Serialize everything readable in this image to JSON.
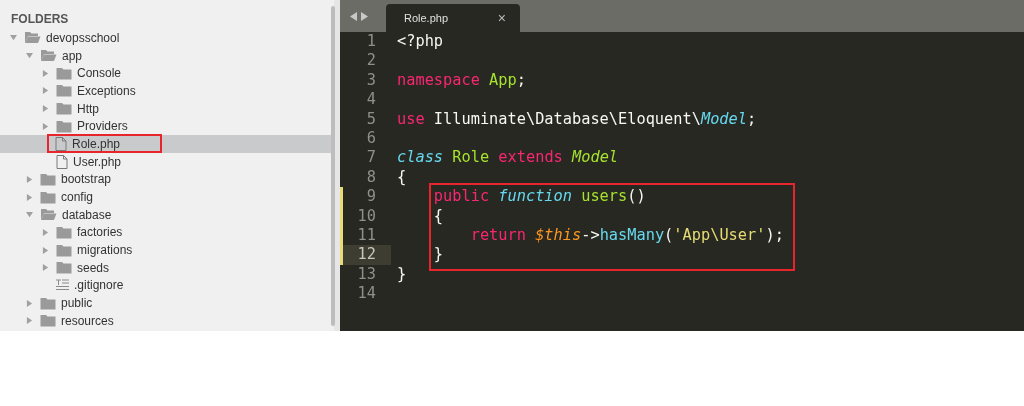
{
  "sidebar": {
    "title": "FOLDERS",
    "tree": [
      {
        "label": "devopsschool",
        "kind": "folder",
        "expanded": true,
        "selected": false,
        "children": [
          {
            "label": "app",
            "kind": "folder",
            "expanded": true,
            "selected": false,
            "children": [
              {
                "label": "Console",
                "kind": "folder",
                "expanded": false,
                "selected": false
              },
              {
                "label": "Exceptions",
                "kind": "folder",
                "expanded": false,
                "selected": false
              },
              {
                "label": "Http",
                "kind": "folder",
                "expanded": false,
                "selected": false
              },
              {
                "label": "Providers",
                "kind": "folder",
                "expanded": false,
                "selected": false
              },
              {
                "label": "Role.php",
                "kind": "file",
                "selected": true,
                "annotated": true
              },
              {
                "label": "User.php",
                "kind": "file",
                "selected": false,
                "annotated": false
              }
            ]
          },
          {
            "label": "bootstrap",
            "kind": "folder",
            "expanded": false,
            "selected": false
          },
          {
            "label": "config",
            "kind": "folder",
            "expanded": false,
            "selected": false
          },
          {
            "label": "database",
            "kind": "folder",
            "expanded": true,
            "selected": false,
            "children": [
              {
                "label": "factories",
                "kind": "folder",
                "expanded": false,
                "selected": false
              },
              {
                "label": "migrations",
                "kind": "folder",
                "expanded": false,
                "selected": false
              },
              {
                "label": "seeds",
                "kind": "folder",
                "expanded": false,
                "selected": false
              },
              {
                "label": ".gitignore",
                "kind": "text",
                "selected": false,
                "annotated": false
              }
            ]
          },
          {
            "label": "public",
            "kind": "folder",
            "expanded": false,
            "selected": false
          },
          {
            "label": "resources",
            "kind": "folder",
            "expanded": false,
            "selected": false
          }
        ]
      }
    ]
  },
  "tabs": [
    {
      "label": "Role.php",
      "close": "×",
      "selected": true
    }
  ],
  "editor": {
    "lines": [
      {
        "kind": "line",
        "number": "1",
        "current": false,
        "modified": false,
        "tokens": [
          {
            "text": "<?php",
            "kind": "plain"
          }
        ]
      },
      {
        "kind": "line",
        "number": "2",
        "current": false,
        "modified": false
      },
      {
        "kind": "line",
        "number": "3",
        "current": false,
        "modified": false,
        "tokens": [
          {
            "text": "namespace ",
            "kind": "keyword"
          },
          {
            "text": "App",
            "kind": "name"
          },
          {
            "text": ";",
            "kind": "plain"
          }
        ]
      },
      {
        "kind": "line",
        "number": "4",
        "current": false,
        "modified": false
      },
      {
        "kind": "line",
        "number": "5",
        "current": false,
        "modified": false,
        "tokens": [
          {
            "text": "use ",
            "kind": "keyword"
          },
          {
            "text": "Illuminate\\Database\\Eloquent\\",
            "kind": "plain"
          },
          {
            "text": "Model",
            "kind": "type"
          },
          {
            "text": ";",
            "kind": "plain"
          }
        ]
      },
      {
        "kind": "line",
        "number": "6",
        "current": false,
        "modified": false
      },
      {
        "kind": "line",
        "number": "7",
        "current": false,
        "modified": false,
        "tokens": [
          {
            "text": "class ",
            "kind": "storage"
          },
          {
            "text": "Role ",
            "kind": "name"
          },
          {
            "text": "extends ",
            "kind": "keyword"
          },
          {
            "text": "Model",
            "kind": "parent"
          }
        ]
      },
      {
        "kind": "line",
        "number": "8",
        "current": false,
        "modified": false,
        "tokens": [
          {
            "text": "{",
            "kind": "plain"
          }
        ]
      },
      {
        "kind": "annotation",
        "lines": [
          {
            "kind": "line",
            "number": "9",
            "current": false,
            "modified": true,
            "tokens": [
              {
                "text": "    public ",
                "kind": "keyword"
              },
              {
                "text": "function ",
                "kind": "storage"
              },
              {
                "text": "users",
                "kind": "name"
              },
              {
                "text": "()",
                "kind": "plain"
              }
            ]
          },
          {
            "kind": "line",
            "number": "10",
            "current": false,
            "modified": true,
            "tokens": [
              {
                "text": "    {",
                "kind": "plain"
              }
            ]
          },
          {
            "kind": "line",
            "number": "11",
            "current": false,
            "modified": true,
            "tokens": [
              {
                "text": "        return ",
                "kind": "keyword"
              },
              {
                "text": "$this",
                "kind": "variable"
              },
              {
                "text": "->",
                "kind": "plain"
              },
              {
                "text": "hasMany",
                "kind": "call"
              },
              {
                "text": "(",
                "kind": "plain"
              },
              {
                "text": "'App\\User'",
                "kind": "string"
              },
              {
                "text": ");",
                "kind": "plain"
              }
            ]
          },
          {
            "kind": "line",
            "number": "12",
            "current": true,
            "modified": true,
            "tokens": [
              {
                "text": "    }",
                "kind": "plain"
              }
            ]
          }
        ]
      },
      {
        "kind": "line",
        "number": "13",
        "current": false,
        "modified": false,
        "tokens": [
          {
            "text": "}",
            "kind": "plain"
          }
        ]
      },
      {
        "kind": "line",
        "number": "14",
        "current": false,
        "modified": false
      }
    ]
  }
}
